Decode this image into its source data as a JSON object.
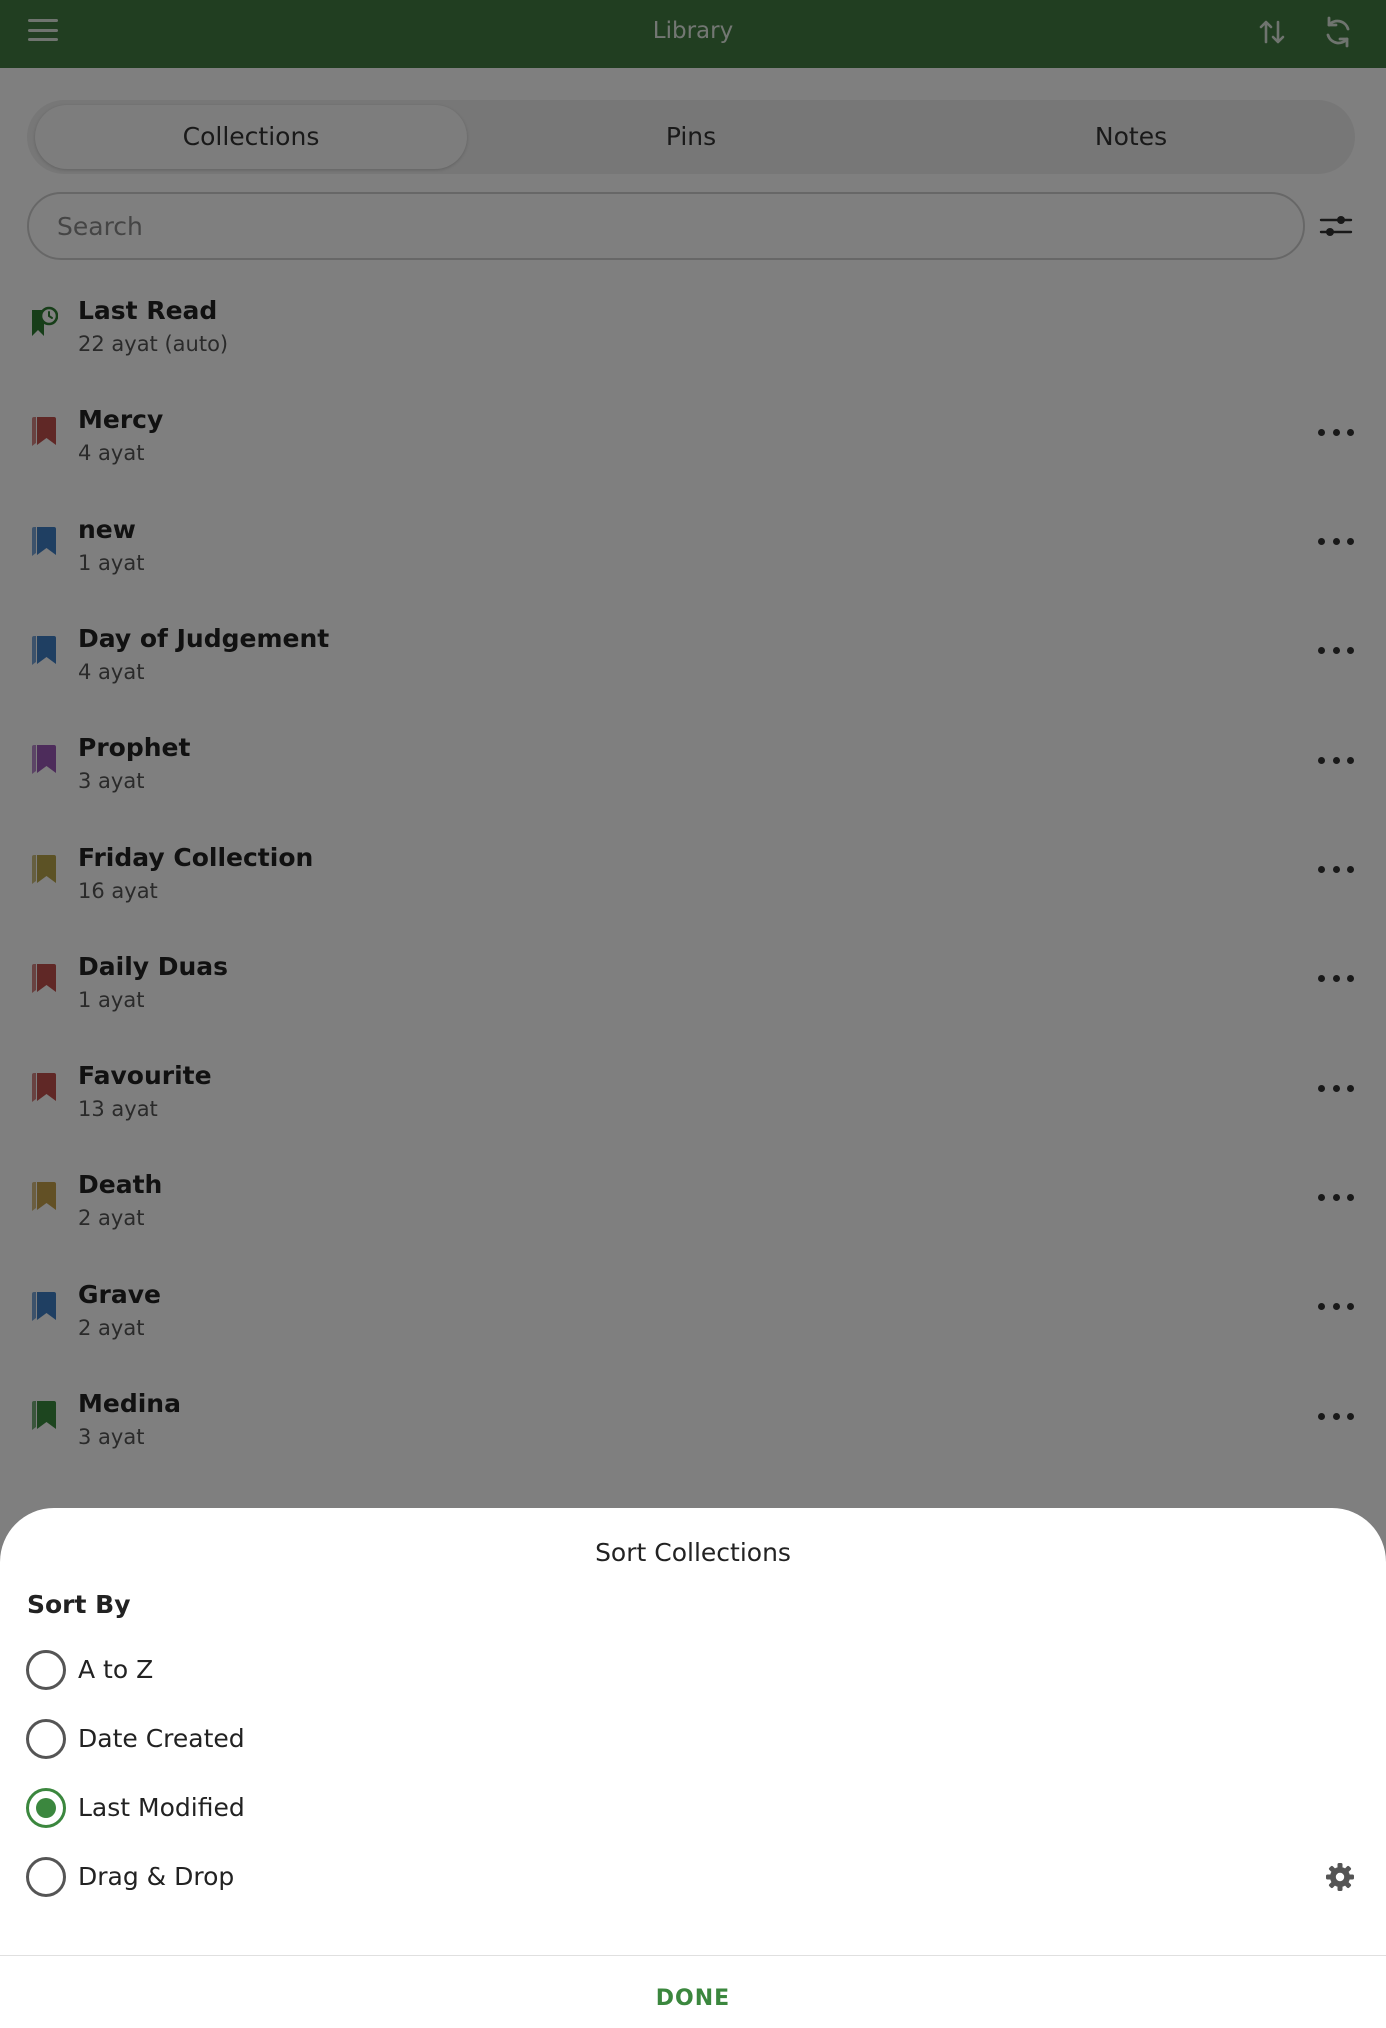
{
  "topbar": {
    "title": "Library"
  },
  "tabs": [
    {
      "label": "Collections",
      "active": true
    },
    {
      "label": "Pins",
      "active": false
    },
    {
      "label": "Notes",
      "active": false
    }
  ],
  "search": {
    "placeholder": "Search",
    "value": ""
  },
  "collections": [
    {
      "name": "Last Read",
      "count": "22 ayat (auto)",
      "color": "#2e7d32",
      "icon": "last-read-icon"
    },
    {
      "name": "Mercy",
      "count": "4 ayat",
      "color": "#c0504d",
      "icon": "bookmark-icon"
    },
    {
      "name": "new",
      "count": "1 ayat",
      "color": "#3f7fc4",
      "icon": "bookmark-icon"
    },
    {
      "name": "Day of Judgement",
      "count": "4 ayat",
      "color": "#3f7fc4",
      "icon": "bookmark-icon"
    },
    {
      "name": "Prophet",
      "count": "3 ayat",
      "color": "#9b59b6",
      "icon": "bookmark-icon"
    },
    {
      "name": "Friday Collection",
      "count": "16 ayat",
      "color": "#b8a44a",
      "icon": "bookmark-icon"
    },
    {
      "name": "Daily Duas",
      "count": "1 ayat",
      "color": "#c0504d",
      "icon": "bookmark-icon"
    },
    {
      "name": "Favourite",
      "count": "13 ayat",
      "color": "#c0504d",
      "icon": "bookmark-icon"
    },
    {
      "name": "Death",
      "count": "2 ayat",
      "color": "#c4a04a",
      "icon": "bookmark-icon"
    },
    {
      "name": "Grave",
      "count": "2 ayat",
      "color": "#3f7fc4",
      "icon": "bookmark-icon"
    },
    {
      "name": "Medina",
      "count": "3 ayat",
      "color": "#3a8a3e",
      "icon": "bookmark-icon"
    }
  ],
  "sheet": {
    "title": "Sort Collections",
    "sort_by_label": "Sort By",
    "options": [
      {
        "label": "A to Z",
        "selected": false
      },
      {
        "label": "Date Created",
        "selected": false
      },
      {
        "label": "Last Modified",
        "selected": true
      },
      {
        "label": "Drag & Drop",
        "selected": false
      }
    ],
    "done_label": "DONE"
  },
  "colors": {
    "primary": "#427c42",
    "accent": "#3b873e"
  }
}
